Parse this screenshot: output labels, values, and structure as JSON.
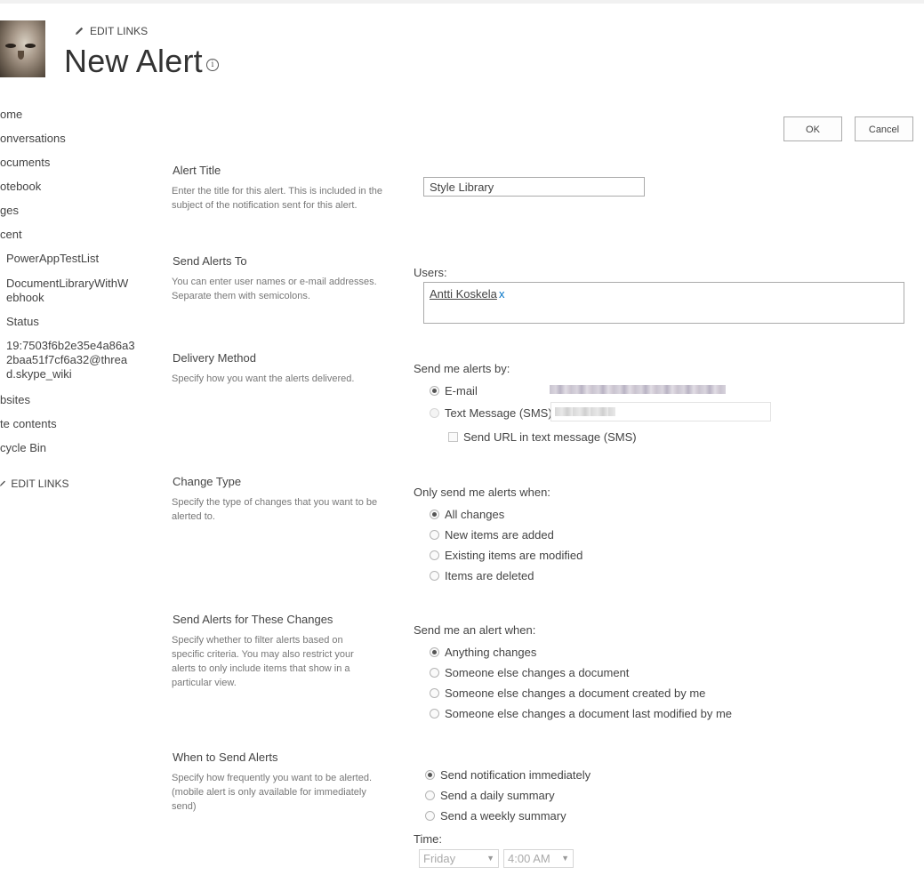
{
  "header": {
    "edit_links": "EDIT LINKS",
    "page_title": "New Alert",
    "info_glyph": "i"
  },
  "quicklaunch": {
    "items": [
      "ome",
      "onversations",
      "ocuments",
      "otebook",
      "ges",
      "cent"
    ],
    "recent": [
      "PowerAppTestList",
      "DocumentLibraryWithW\nebhook",
      "Status",
      "19:7503f6b2e35e4a86a3\n2baa51f7cf6a32@threa\nd.skype_wiki"
    ],
    "items_after": [
      "bsites",
      "te contents",
      "cycle Bin"
    ],
    "edit_links": "EDIT LINKS"
  },
  "toolbar": {
    "ok_label": "OK",
    "cancel_label": "Cancel"
  },
  "alert_title": {
    "title": "Alert Title",
    "description": "Enter the title for this alert. This is included in the subject of the notification sent for this alert.",
    "value": "Style Library"
  },
  "send_to": {
    "title": "Send Alerts To",
    "description": "You can enter user names or e-mail addresses. Separate them with semicolons.",
    "users_label": "Users:",
    "user": "Antti Koskela",
    "remove_glyph": "x"
  },
  "delivery": {
    "title": "Delivery Method",
    "description": "Specify how you want the alerts delivered.",
    "prompt": "Send me alerts by:",
    "email_label": "E-mail",
    "sms_label": "Text Message (SMS)",
    "sms_url_label": "Send URL in text message (SMS)"
  },
  "change_type": {
    "title": "Change Type",
    "description": "Specify the type of changes that you want to be alerted to.",
    "prompt": "Only send me alerts when:",
    "options": [
      "All changes",
      "New items are added",
      "Existing items are modified",
      "Items are deleted"
    ]
  },
  "filter": {
    "title": "Send Alerts for These Changes",
    "description": "Specify whether to filter alerts based on specific criteria. You may also restrict your alerts to only include items that show in a particular view.",
    "prompt": "Send me an alert when:",
    "options": [
      "Anything changes",
      "Someone else changes a document",
      "Someone else changes a document created by me",
      "Someone else changes a document last modified by me"
    ]
  },
  "when": {
    "title": "When to Send Alerts",
    "description": "Specify how frequently you want to be alerted. (mobile alert is only available for immediately send)",
    "options": [
      "Send notification immediately",
      "Send a daily summary",
      "Send a weekly summary"
    ],
    "time_label": "Time:",
    "day_value": "Friday",
    "time_value": "4:00 AM",
    "caret_glyph": "▼"
  }
}
